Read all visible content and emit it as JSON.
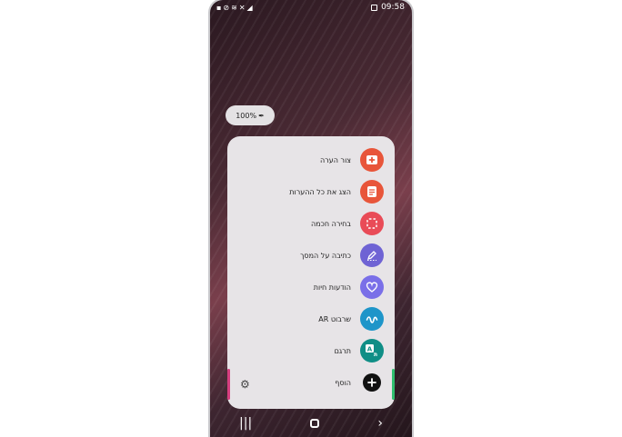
{
  "status_bar": {
    "time": "09:58",
    "left_icons": [
      "lock-icon",
      "blocked-icon",
      "wifi-icon",
      "mute-icon",
      "signal-icon"
    ],
    "right_icons": [
      "image-icon"
    ]
  },
  "pen_pill": {
    "battery": "100%"
  },
  "menu": {
    "items": [
      {
        "label": "צור הערה",
        "icon": "create-note-icon",
        "color": "#e8553a",
        "glyph": "+"
      },
      {
        "label": "הצג את כל ההערות",
        "icon": "view-notes-icon",
        "color": "#e8553a",
        "glyph": "≡"
      },
      {
        "label": "בחירה חכמה",
        "icon": "smart-select-icon",
        "color": "#e94b57",
        "glyph": "⬚"
      },
      {
        "label": "כתיבה על המסך",
        "icon": "screen-write-icon",
        "color": "#6f63d4",
        "glyph": "✎"
      },
      {
        "label": "הודעות חיות",
        "icon": "live-messages-icon",
        "color": "#7a6fe8",
        "glyph": "♡"
      },
      {
        "label": "שרבוט AR",
        "icon": "ar-doodle-icon",
        "color": "#1e95c9",
        "glyph": "∿"
      },
      {
        "label": "תרגם",
        "icon": "translate-icon",
        "color": "#108e86",
        "glyph": "A"
      },
      {
        "label": "הוסף",
        "icon": "add-icon",
        "color": "#111111",
        "glyph": "+"
      }
    ]
  },
  "navbar": {
    "recent": "|||",
    "back": "›"
  }
}
